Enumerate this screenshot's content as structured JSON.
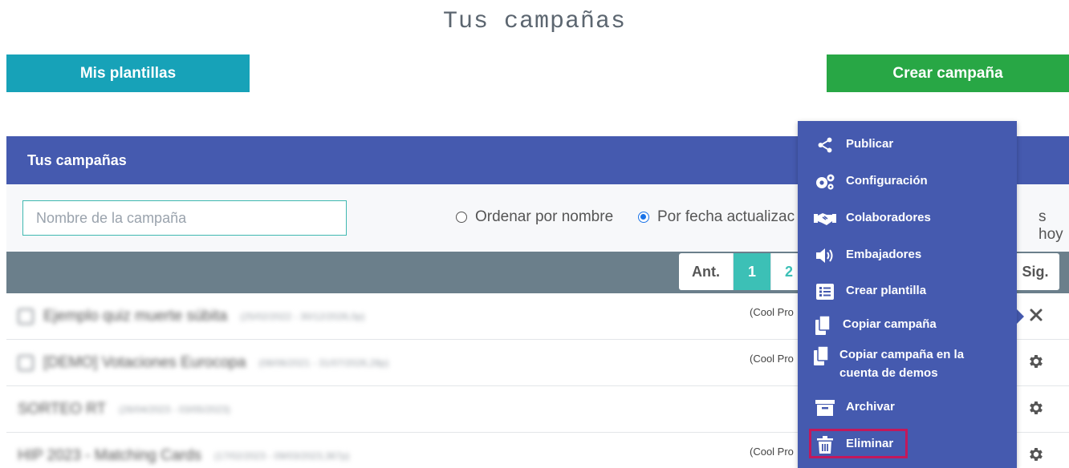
{
  "page": {
    "title": "Tus campañas"
  },
  "actions": {
    "templates_label": "Mis plantillas",
    "create_label": "Crear campaña"
  },
  "panel": {
    "title": "Tus campañas"
  },
  "filters": {
    "search_placeholder": "Nombre de la campaña",
    "search_value": "",
    "sort_by_name": "Ordenar por nombre",
    "sort_by_date": "Por fecha actualizac",
    "trailing_text": "s hoy",
    "selected": "sort_by_date"
  },
  "pagination": {
    "prev": "Ant.",
    "pages": [
      "1",
      "2"
    ],
    "current": "1",
    "next": "Sig."
  },
  "campaigns": [
    {
      "name": "Ejemplo quiz muerte súbita",
      "dates": "(25/02/2022 - 30/12/2026,0p)",
      "owner": "(Cool Pro",
      "action": "close-icon"
    },
    {
      "name": "[DEMO] Votaciones Eurocopa",
      "dates": "(08/06/2021 - 31/07/2026,28p)",
      "owner": "(Cool Pro",
      "action": "gear-icon"
    },
    {
      "name": "SORTEO RT",
      "dates": "(26/04/2023 - 03/05/2023)",
      "owner": "",
      "action": "gear-icon"
    },
    {
      "name": "HIP 2023 - Matching Cards",
      "dates": "(17/02/2023 - 09/03/2023,367p)",
      "owner": "(Cool Pro",
      "action": "gear-icon"
    }
  ],
  "context_menu": {
    "items": [
      {
        "label": "Publicar",
        "icon": "share-icon"
      },
      {
        "label": "Configuración",
        "icon": "gears-icon"
      },
      {
        "label": "Colaboradores",
        "icon": "handshake-icon"
      },
      {
        "label": "Embajadores",
        "icon": "megaphone-icon"
      },
      {
        "label": "Crear plantilla",
        "icon": "list-icon"
      },
      {
        "label": "Copiar campaña",
        "icon": "copy-icon"
      },
      {
        "label": "Copiar campaña en la cuenta de demos",
        "icon": "copy-icon"
      },
      {
        "label": "Archivar",
        "icon": "archive-icon"
      },
      {
        "label": "Eliminar",
        "icon": "trash-icon",
        "highlighted": true
      }
    ]
  },
  "colors": {
    "primary": "#455aaf",
    "teal": "#17a2b8",
    "green": "#28a745",
    "highlight": "#c2185b"
  }
}
